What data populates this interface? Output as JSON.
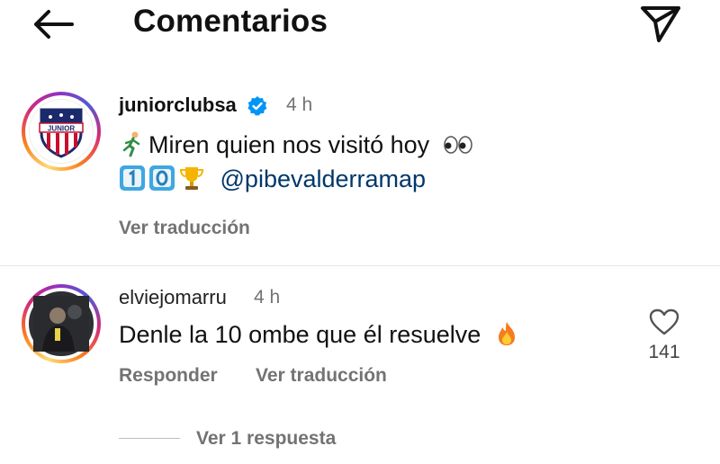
{
  "header": {
    "title": "Comentarios",
    "back_icon": "arrow-left-icon",
    "send_icon": "paper-plane-icon"
  },
  "post": {
    "username": "juniorclubsa",
    "verified": true,
    "time": "4 h",
    "caption_line1": "Miren quien nos visitó hoy",
    "mention": "@pibevalderramap",
    "translate_label": "Ver traducción",
    "avatar_badge_text": "JUNIOR"
  },
  "comment": {
    "username": "elviejomarru",
    "time": "4 h",
    "text": "Denle la 10 ombe que él resuelve",
    "like_count": "141",
    "reply_label": "Responder",
    "translate_label": "Ver traducción",
    "view_replies_label": "Ver 1 respuesta"
  },
  "colors": {
    "secondary_text": "#737373",
    "mention": "#00376b",
    "verified_blue": "#0095f6"
  }
}
